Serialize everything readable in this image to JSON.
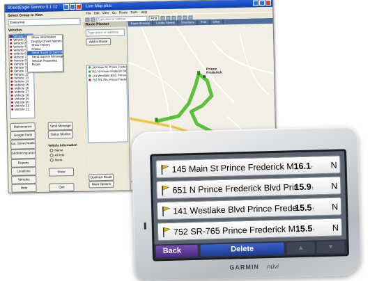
{
  "desktop": {
    "left_window": {
      "title": "StreetEagle Service 3.1.12",
      "group_label": "Select Group to View",
      "group_value": "Everyone",
      "list_header": "Vehicles",
      "vehicles": [
        "Vehicle 1",
        "Vehicle 2",
        "Vehicle 3",
        "Vehicle 4",
        "Vehicle 5",
        "Vehicle 6",
        "Vehicle 7",
        "Vehicle 8",
        "Vehicle 9",
        "Vehicle 10",
        "Vehicle 11",
        "Vehicle 12",
        "Vehicle 13",
        "Vehicle 14",
        "Vehicle 15",
        "Vehicle 16",
        "Vehicle 17",
        "Vehicle 18",
        "Vehicle 19",
        "Vehicle 20",
        "Vehicle 21",
        "Vehicle 22"
      ],
      "context_menu": [
        "Show Information",
        "Display Driver Names",
        "Show History",
        "Follow",
        "Send Route to Garmin",
        "Send Garmin Message",
        "Vehicle Properties",
        "Route"
      ],
      "buttons": {
        "maintenance": "Maintenance",
        "send_message": "Send Message",
        "google_earth": "Google Earth",
        "status_monitor": "Status Monitor",
        "geo_fence": "Go. Street Notifications",
        "geofencing": "Geofencing and Alerts",
        "reports": "Reports",
        "locations": "Locations",
        "show": "Show",
        "vehicles": "Vehicles",
        "help": "Help",
        "quit": "Quit"
      },
      "vehicle_info_label": "Vehicle Information",
      "radios": [
        "Name",
        "All Info",
        "None"
      ]
    },
    "right_window": {
      "title": "Live Map plus",
      "menu": "File  Edit  View  Go  Route  Tools  Help",
      "search_placeholder": "Type place or address",
      "find_button": "Find",
      "route_planner_title": "Route Planner",
      "route_input_placeholder": "Type place or address",
      "add_to_route": "Add to Route",
      "route_items": [
        "145 Main St, Prince Frederick",
        "651 N Prince Frederick Blvd, Prince",
        "141 Westlake Blvd, Prince Frederick",
        "752 SR-765, Prince Frederick, MD"
      ],
      "optimize_route": "Optimize Route",
      "more_options": "More Options",
      "map_tabs": [
        "Route Itinerary",
        "Locate Streets",
        "Directions",
        "Print",
        "Other"
      ],
      "map_label": "Prince Frederick"
    }
  },
  "garmin": {
    "rows": [
      {
        "text": "145 Main St  Prince Frederick  M",
        "dist": "16.1",
        "unit": "↑",
        "dir": "N"
      },
      {
        "text": "651 N Prince Frederick Blvd  Prir",
        "dist": "15.9",
        "unit": "↑",
        "dir": "N"
      },
      {
        "text": "141 Westlake Blvd  Prince Frede",
        "dist": "15.5",
        "unit": "↑",
        "dir": "N"
      },
      {
        "text": "752 SR-765  Prince Frederick  M",
        "dist": "15.5",
        "unit": "↑",
        "dir": "N"
      }
    ],
    "back_label": "Back",
    "delete_label": "Delete",
    "up_label": "▲",
    "down_label": "▼",
    "brand": "GARMIN",
    "model": "nüvi"
  },
  "colors": {
    "route_green": "#5cc03a",
    "road_yellow": "#f2d25a",
    "back_purple": "#5a3496",
    "delete_blue": "#2a4db0"
  }
}
